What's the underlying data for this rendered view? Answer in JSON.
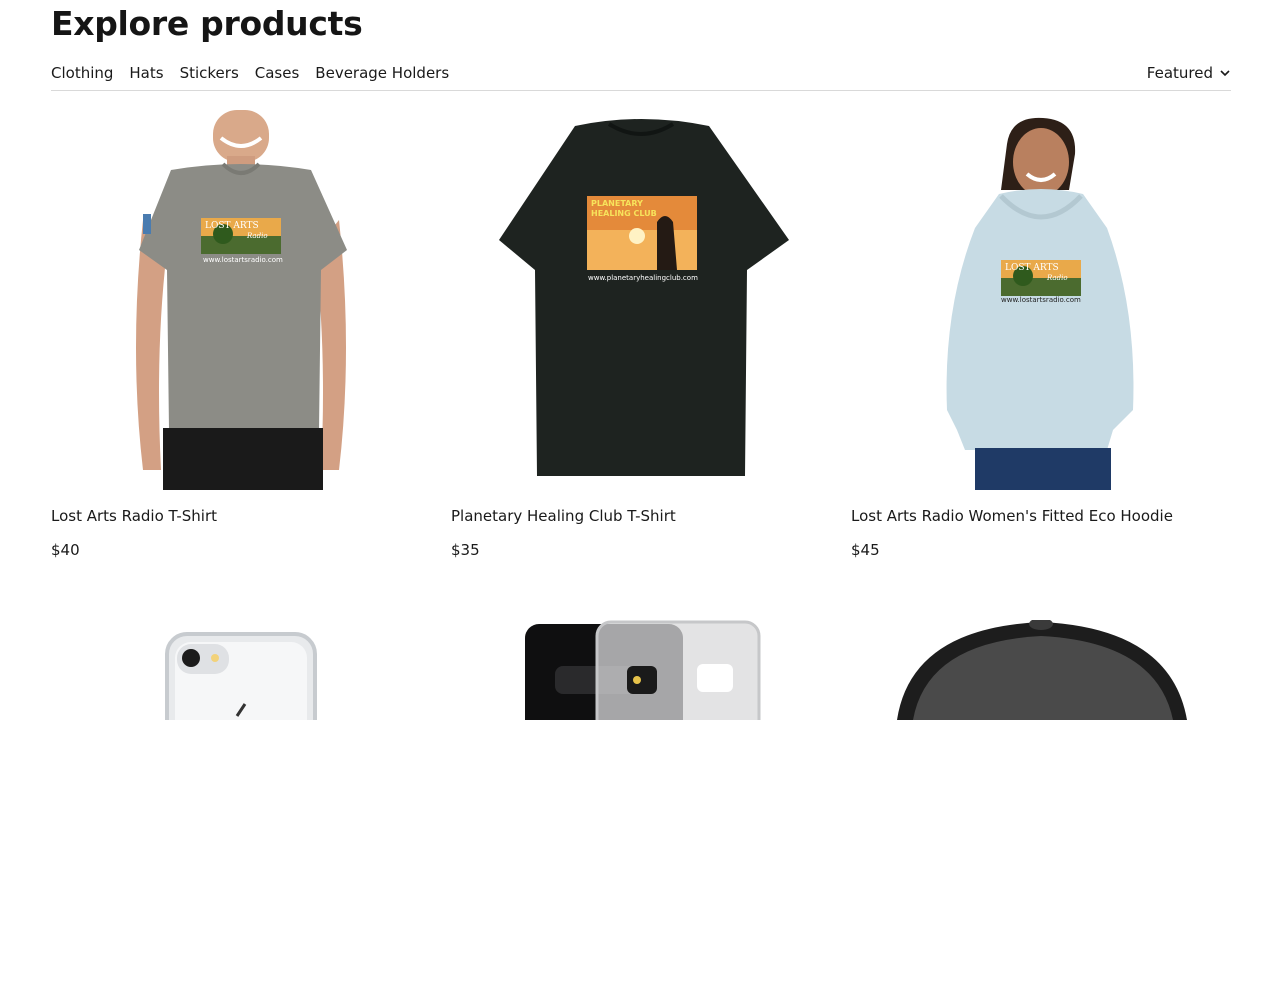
{
  "header": {
    "title": "Explore products"
  },
  "filters": [
    "Clothing",
    "Hats",
    "Stickers",
    "Cases",
    "Beverage Holders"
  ],
  "sort": {
    "label": "Featured"
  },
  "products": [
    {
      "name": "Lost Arts Radio T-Shirt",
      "price": "$40",
      "print_heading": "LOST ARTS",
      "print_sub": "Radio",
      "print_url": "www.lostartsradio.com"
    },
    {
      "name": "Planetary Healing Club T-Shirt",
      "price": "$35",
      "print_heading": "PLANETARY",
      "print_sub": "HEALING CLUB",
      "print_url": "www.planetaryhealingclub.com"
    },
    {
      "name": "Lost Arts Radio Women's Fitted Eco Hoodie",
      "price": "$45",
      "print_heading": "LOST ARTS",
      "print_sub": "Radio",
      "print_url": "www.lostartsradio.com"
    }
  ],
  "colors": {
    "gray_shirt": "#8c8c86",
    "dark_shirt": "#1e2320",
    "hoodie": "#c7dbe4",
    "divider": "#d9d9d9"
  },
  "icons": [
    "chevron-down-icon"
  ]
}
